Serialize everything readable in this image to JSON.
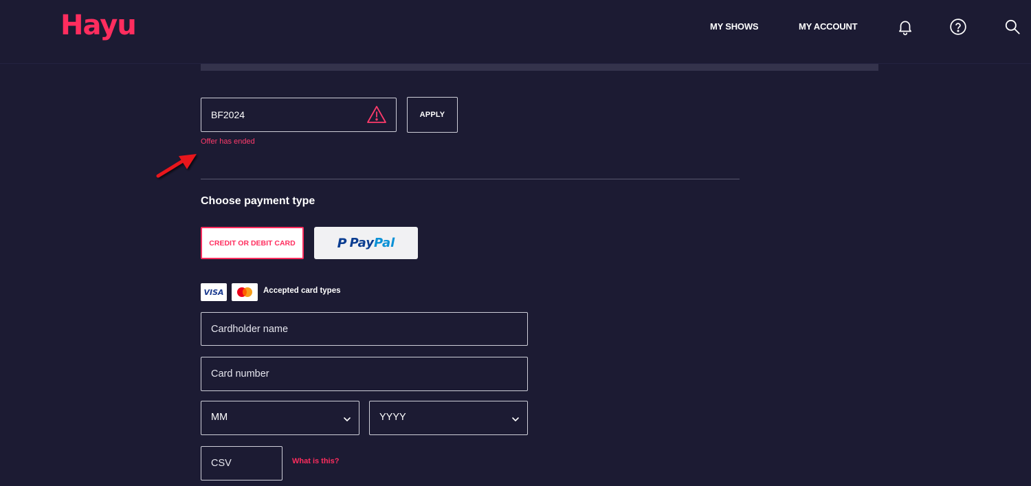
{
  "header": {
    "logo": "Hayu",
    "nav": {
      "my_shows": "MY SHOWS",
      "my_account": "MY ACCOUNT"
    },
    "icons": [
      "bell-icon",
      "help-icon",
      "search-icon"
    ]
  },
  "promo": {
    "code_value": "BF2024",
    "apply_label": "APPLY",
    "error": "Offer has ended",
    "status": "error"
  },
  "payment": {
    "title": "Choose payment type",
    "card_option_label": "CREDIT OR DEBIT CARD",
    "paypal": {
      "mark": "P",
      "pay": "Pay",
      "pal": "Pal"
    },
    "card_types": {
      "visa": "VISA",
      "label": "Accepted card types"
    },
    "fields": {
      "cardholder_placeholder": "Cardholder name",
      "cardnumber_placeholder": "Card number",
      "month": "MM",
      "year": "YYYY",
      "csv_placeholder": "CSV",
      "csv_help": "What is this?"
    }
  },
  "colors": {
    "background": "#1c1b33",
    "brand": "#ff2d5e",
    "error": "#ff3b6b",
    "paypal_dark": "#0b3d91",
    "paypal_light": "#0a91d6"
  }
}
